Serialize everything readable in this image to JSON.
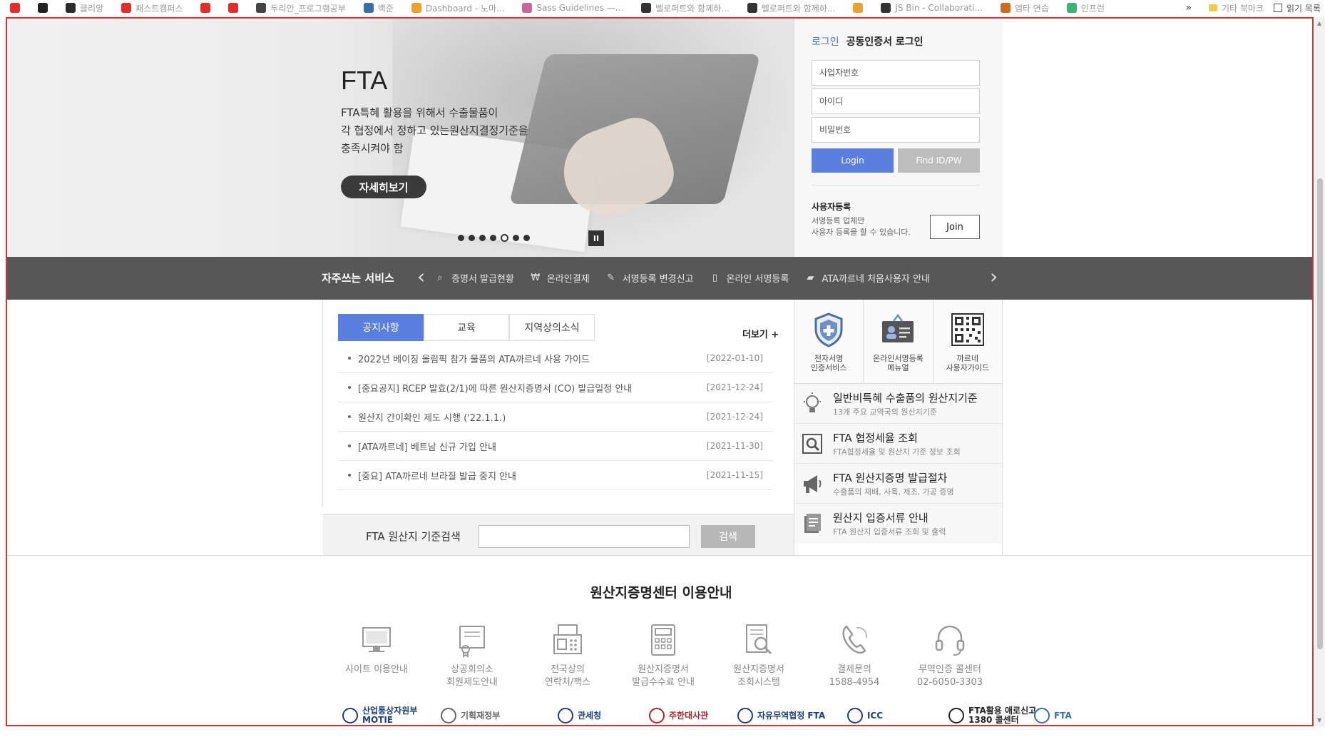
{
  "bookmarks": [
    {
      "label": "",
      "color": "#e52d27"
    },
    {
      "label": "",
      "color": "#222222"
    },
    {
      "label": "클리앙",
      "color": "#2b2b2b"
    },
    {
      "label": "패스트캠퍼스",
      "color": "#e52d27"
    },
    {
      "label": "",
      "color": "#e52d27"
    },
    {
      "label": "",
      "color": "#e52d27"
    },
    {
      "label": "두리안_프로그램공부",
      "color": "#444444"
    },
    {
      "label": "백준",
      "color": "#3a6ea5"
    },
    {
      "label": "Dashboard - 노마...",
      "color": "#f0a030"
    },
    {
      "label": "Sass Guidelines —...",
      "color": "#cc6699"
    },
    {
      "label": "벨로퍼트와 함께하...",
      "color": "#333333"
    },
    {
      "label": "벨로퍼트와 함께하...",
      "color": "#333333"
    },
    {
      "label": "",
      "color": "#f0a030"
    },
    {
      "label": "JS Bin - Collaborati...",
      "color": "#333333"
    },
    {
      "label": "엠타 연습",
      "color": "#d2691e"
    },
    {
      "label": "인프런",
      "color": "#3cb371"
    }
  ],
  "bookmarks_right": {
    "chevron": "»",
    "other": "기타 북마크",
    "reading": "읽기 목록"
  },
  "hero": {
    "title": "FTA",
    "desc": [
      "FTA특혜 활용을 위해서 수출물품이",
      "각 협정에서 정하고 있는원산지결정기준을",
      "충족시켜야 함"
    ],
    "button": "자세히보기",
    "slide_count": 7,
    "active_slide": 5,
    "pause": "II"
  },
  "login": {
    "tab_login": "로그인",
    "tab_cert": "공동인증서 로그인",
    "field_biz": "사업자번호",
    "field_id": "아이디",
    "field_pw": "비밀번호",
    "btn_login": "Login",
    "btn_find": "Find ID/PW",
    "reg_title": "사용자등록",
    "reg_desc1": "서명등록 업체만",
    "reg_desc2": "사용자 등록을 할 수 있습니다.",
    "btn_join": "Join"
  },
  "quick": {
    "title": "자주쓰는 서비스",
    "prev": "‹",
    "next": "›",
    "items": [
      {
        "label": "증명서 발급현황",
        "icon": "search-icon"
      },
      {
        "label": "온라인결제",
        "icon": "won-icon"
      },
      {
        "label": "서명등록 변경신고",
        "icon": "pen-icon"
      },
      {
        "label": "온라인 서명등록",
        "icon": "phone-icon"
      },
      {
        "label": "ATA까르네 처음사용자 안내",
        "icon": "folder-icon"
      }
    ]
  },
  "notice": {
    "tabs": [
      "공지사항",
      "교육",
      "지역상의소식"
    ],
    "more": "더보기 +",
    "rows": [
      {
        "title": "2022년 베이징 올림픽 참가 물품의 ATA까르네 사용 가이드",
        "date": "[2022-01-10]"
      },
      {
        "title": "[중요공지] RCEP 발효(2/1)에 따른 원산지증명서 (CO) 발급일정 안내",
        "date": "[2021-12-24]"
      },
      {
        "title": "원산지 간이확인 제도 시행 ('22.1.1.)",
        "date": "[2021-12-24]"
      },
      {
        "title": "[ATA까르네] 베트남 신규 가입 안내",
        "date": "[2021-11-30]"
      },
      {
        "title": "[중요] ATA까르네 브라질 발급 중지 안내",
        "date": "[2021-11-15]"
      }
    ],
    "search_label": "FTA 원산지 기준검색",
    "search_placeholder": "",
    "search_btn": "검색"
  },
  "services": {
    "tiles": [
      {
        "line1": "전자서명",
        "line2": "인증서비스",
        "icon": "shield-plus-icon"
      },
      {
        "line1": "온라인서명등록",
        "line2": "메뉴얼",
        "icon": "id-card-icon"
      },
      {
        "line1": "까르네",
        "line2": "사용자가이드",
        "icon": "qr-code-icon"
      }
    ],
    "rows": [
      {
        "title": "일반비특혜 수출품의 원산지기준",
        "sub": "13개 주요 교역국의 원산지기준",
        "icon": "lightbulb-icon"
      },
      {
        "title": "FTA 협정세율 조회",
        "sub": "FTA협정세율 및 원산지 기준 정보 조회",
        "icon": "magnifier-icon"
      },
      {
        "title": "FTA 원산지증명 발급절차",
        "sub": "수출품의 재배, 사육, 제조, 가공 증명",
        "icon": "megaphone-icon"
      },
      {
        "title": "원산지 입증서류 안내",
        "sub": "FTA 원산지 입증서류 조회 및 출력",
        "icon": "document-icon"
      }
    ]
  },
  "guide": {
    "title": "원산지증명센터 이용안내",
    "items": [
      {
        "line1": "사이트 이용안내",
        "line2": "",
        "icon": "monitor-icon"
      },
      {
        "line1": "상공회의소",
        "line2": "회원제도안내",
        "icon": "certificate-icon"
      },
      {
        "line1": "전국상의",
        "line2": "연락처/팩스",
        "icon": "fax-icon"
      },
      {
        "line1": "원산지증명서",
        "line2": "발급수수료 안내",
        "icon": "calculator-icon"
      },
      {
        "line1": "원산지증명서",
        "line2": "조회시스템",
        "icon": "doc-search-icon"
      },
      {
        "line1": "결제문의",
        "line2": "1588-4954",
        "icon": "phone-handset-icon"
      },
      {
        "line1": "무역인증 콜센터",
        "line2": "02-6050-3303",
        "icon": "headset-icon"
      }
    ]
  },
  "footer": {
    "logos": [
      {
        "label": "산업통상자원부",
        "sub": "MOTIE",
        "icon": "motie-logo-icon"
      },
      {
        "label": "기획재정부",
        "sub": "",
        "icon": "moef-logo-icon"
      },
      {
        "label": "관세청",
        "sub": "",
        "icon": "customs-logo-icon"
      },
      {
        "label": "주한대사관",
        "sub": "",
        "icon": "embassy-logo-icon"
      },
      {
        "label": "자유무역협정 FTA",
        "sub": "",
        "icon": "fta-logo-icon"
      },
      {
        "label": "ICC",
        "sub": "",
        "icon": "icc-logo-icon"
      },
      {
        "label": "FTA활용 애로신고",
        "sub": "1380 콜센터",
        "icon": "callcenter-logo-icon"
      },
      {
        "label": "FTA",
        "sub": "",
        "icon": "fta-box-logo-icon"
      }
    ]
  }
}
